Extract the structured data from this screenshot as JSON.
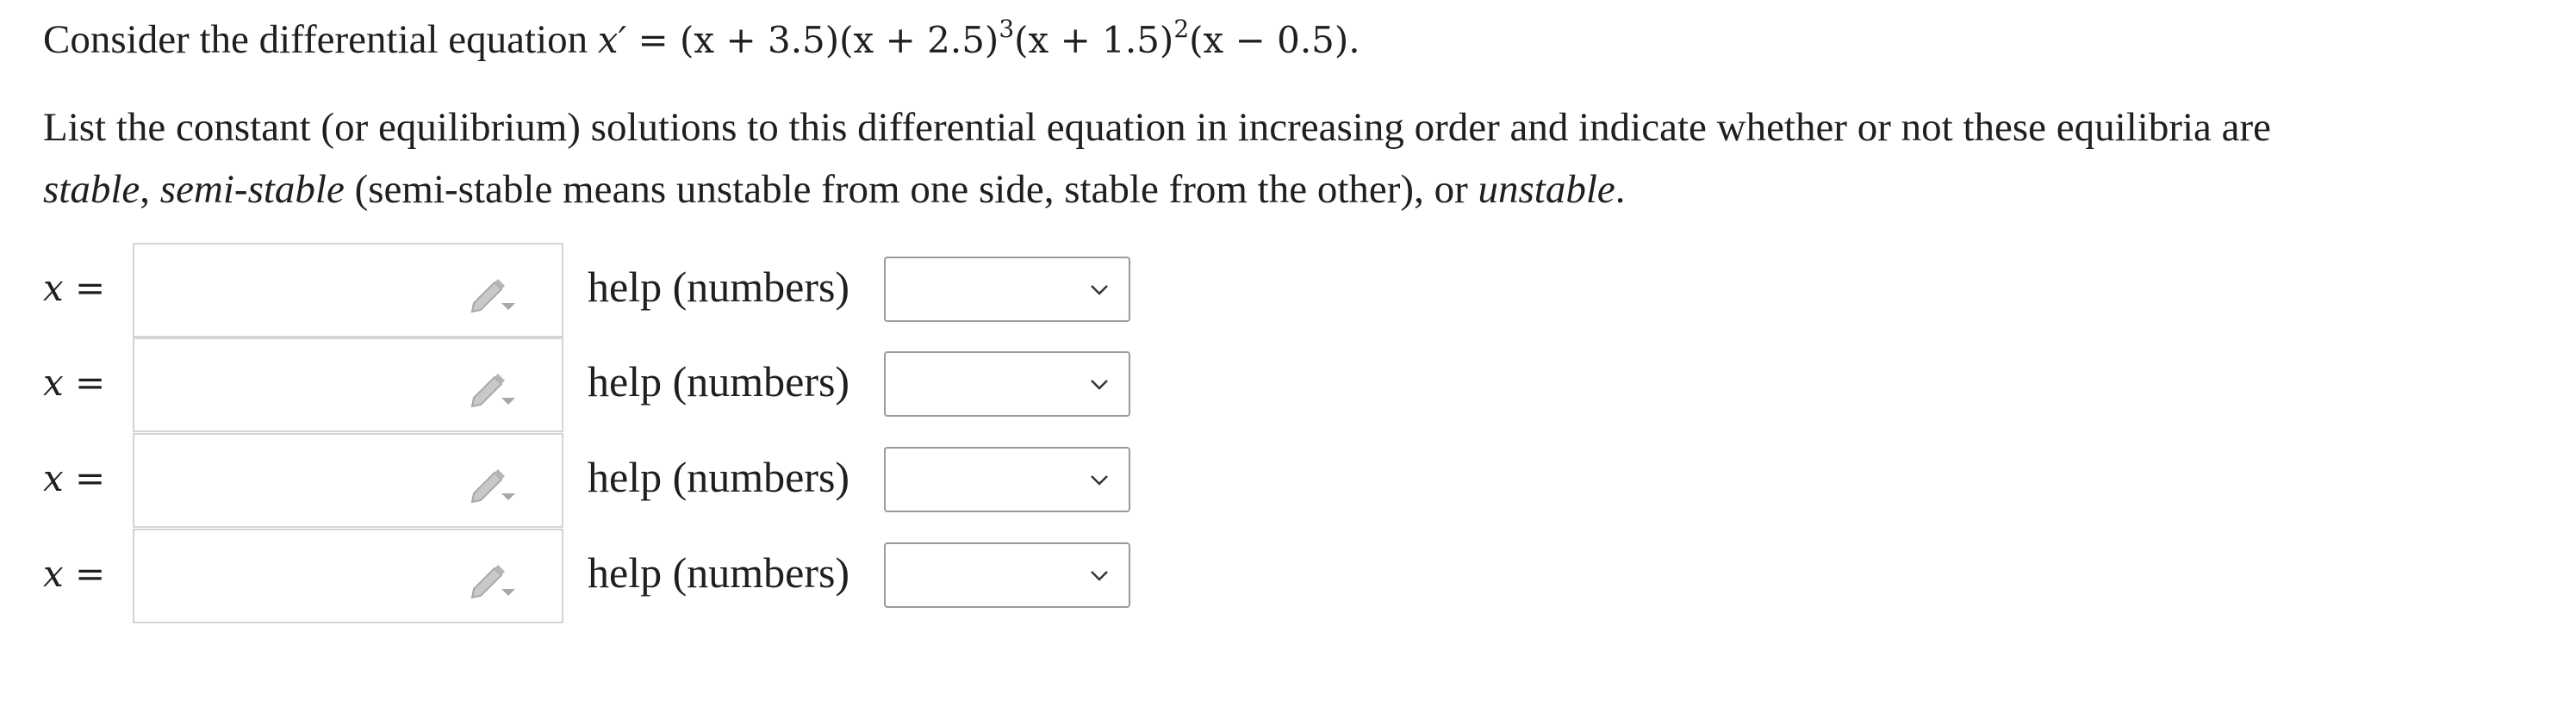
{
  "problem": {
    "intro": "Consider the differential equation",
    "equation": {
      "lhs": "x′ = ",
      "f1": "(x + 3.5)",
      "f2": "(x + 2.5)",
      "f2_exp": "3",
      "f3": "(x + 1.5)",
      "f3_exp": "2",
      "f4": "(x − 0.5)",
      "end": "."
    },
    "instruction_a": "List the constant (or equilibrium) solutions to this differential equation in increasing order and indicate whether or not these equilibria are",
    "instruction_b1": "stable",
    "instruction_b2": ", ",
    "instruction_b3": "semi-stable",
    "instruction_b4": " (semi-stable means unstable from one side, stable from the other), or ",
    "instruction_b5": "unstable",
    "instruction_b6": "."
  },
  "answers": [
    {
      "label_var": "x",
      "label_eq": " =",
      "value": "",
      "help": "help (numbers)",
      "selected": ""
    },
    {
      "label_var": "x",
      "label_eq": " =",
      "value": "",
      "help": "help (numbers)",
      "selected": ""
    },
    {
      "label_var": "x",
      "label_eq": " =",
      "value": "",
      "help": "help (numbers)",
      "selected": ""
    },
    {
      "label_var": "x",
      "label_eq": " =",
      "value": "",
      "help": "help (numbers)",
      "selected": ""
    }
  ],
  "icons": {
    "pencil": "pencil-dropdown-icon",
    "chevron": "chevron-down-icon"
  },
  "colors": {
    "text": "#1f1f1f",
    "box_border": "#d4d4d4",
    "select_border": "#9a9a9a",
    "pencil": "#b5b5b5"
  }
}
